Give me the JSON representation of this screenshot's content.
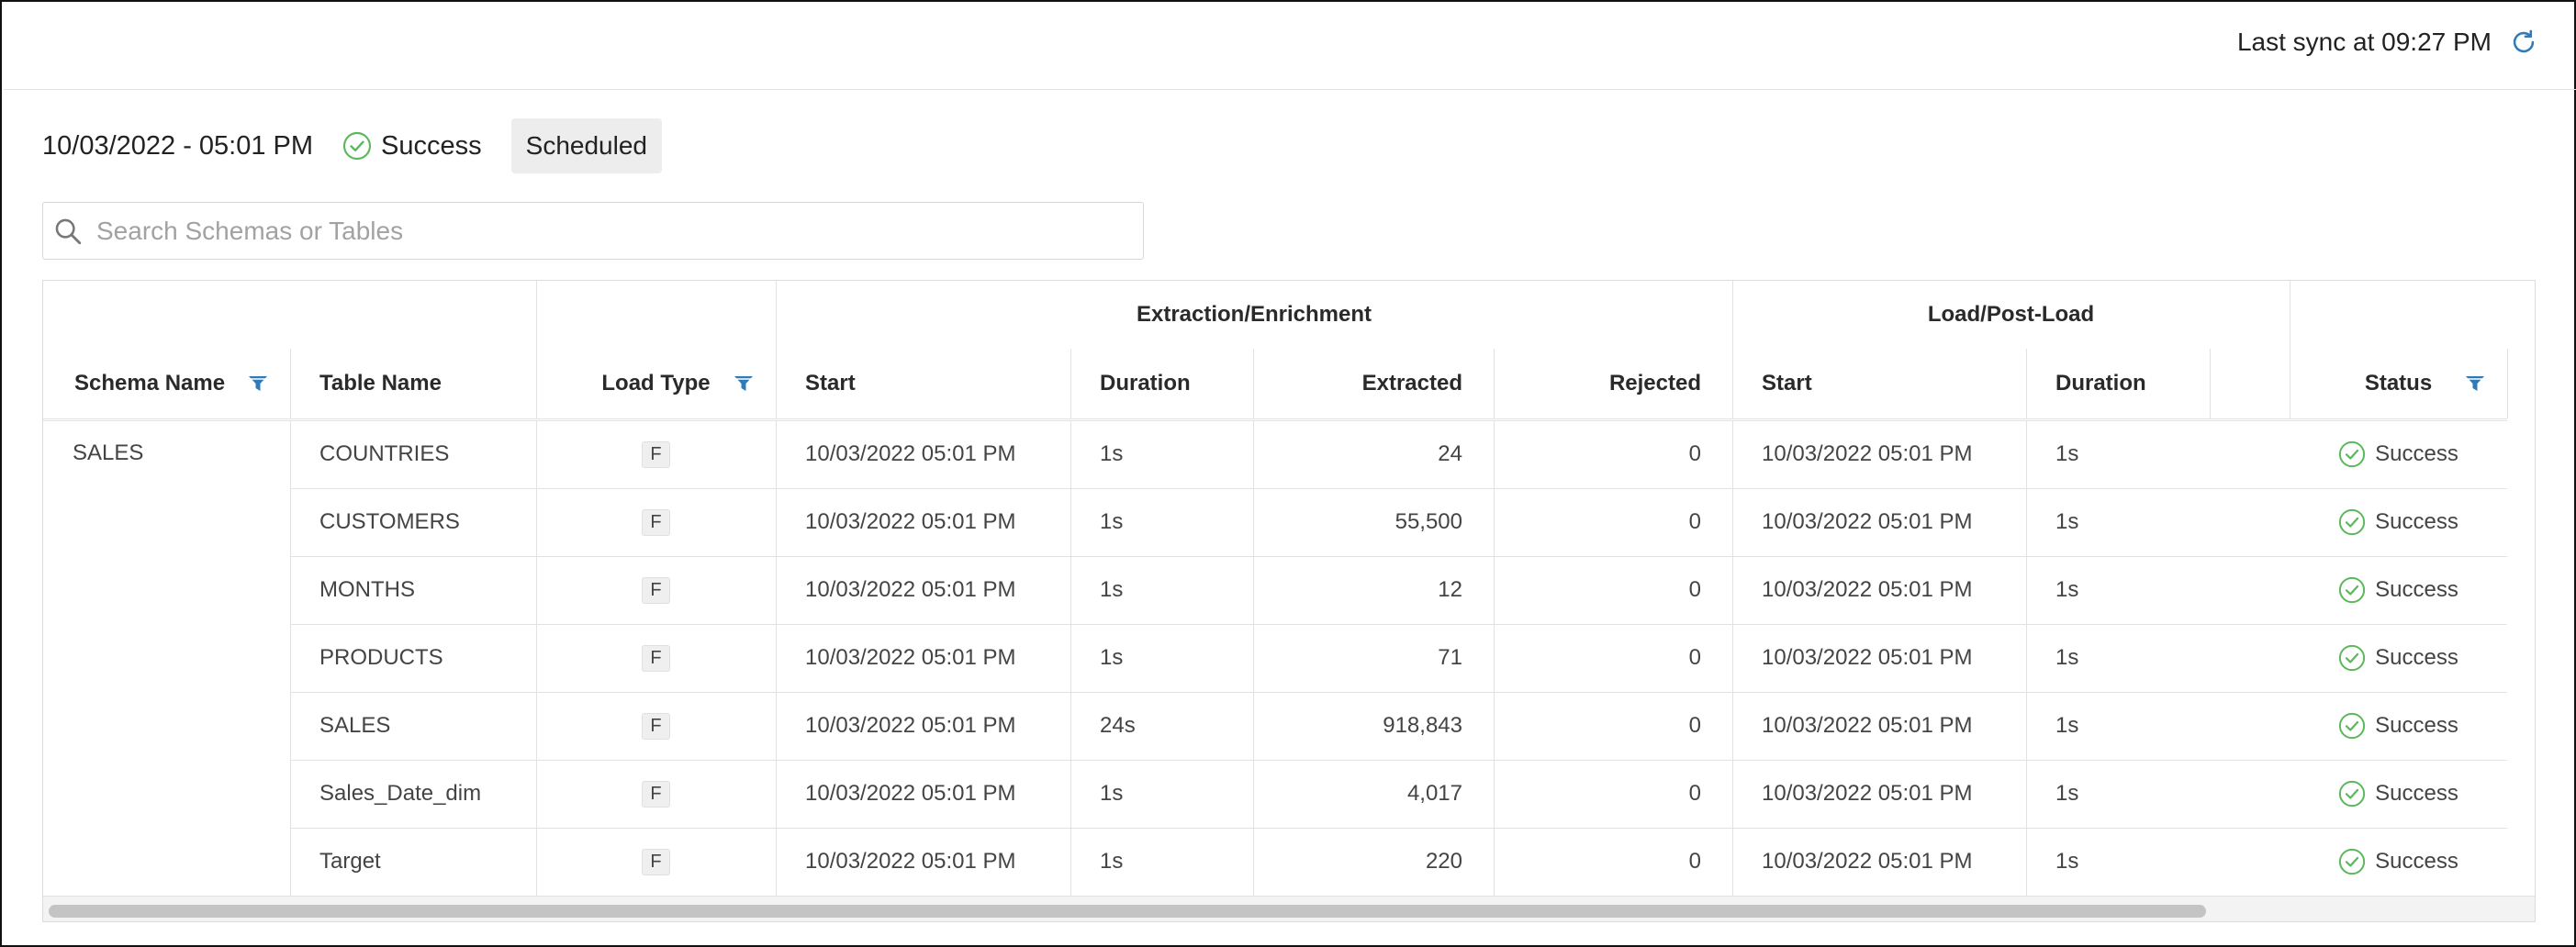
{
  "header": {
    "sync_text": "Last sync at 09:27 PM",
    "refresh_icon": "refresh-icon"
  },
  "run": {
    "date": "10/03/2022 - 05:01 PM",
    "status": "Success",
    "tag": "Scheduled"
  },
  "search": {
    "placeholder": "Search Schemas or Tables",
    "value": ""
  },
  "table": {
    "group_headers": {
      "extraction": "Extraction/Enrichment",
      "load": "Load/Post-Load"
    },
    "columns": {
      "schema": "Schema Name",
      "table": "Table Name",
      "load_type": "Load Type",
      "ext_start": "Start",
      "ext_duration": "Duration",
      "extracted": "Extracted",
      "rejected": "Rejected",
      "load_start": "Start",
      "load_duration": "Duration",
      "status": "Status"
    },
    "schema_value": "SALES",
    "rows": [
      {
        "table": "COUNTRIES",
        "load_type": "F",
        "ext_start": "10/03/2022 05:01 PM",
        "ext_duration": "1s",
        "extracted": "24",
        "rejected": "0",
        "load_start": "10/03/2022 05:01 PM",
        "load_duration": "1s",
        "status": "Success"
      },
      {
        "table": "CUSTOMERS",
        "load_type": "F",
        "ext_start": "10/03/2022 05:01 PM",
        "ext_duration": "1s",
        "extracted": "55,500",
        "rejected": "0",
        "load_start": "10/03/2022 05:01 PM",
        "load_duration": "1s",
        "status": "Success"
      },
      {
        "table": "MONTHS",
        "load_type": "F",
        "ext_start": "10/03/2022 05:01 PM",
        "ext_duration": "1s",
        "extracted": "12",
        "rejected": "0",
        "load_start": "10/03/2022 05:01 PM",
        "load_duration": "1s",
        "status": "Success"
      },
      {
        "table": "PRODUCTS",
        "load_type": "F",
        "ext_start": "10/03/2022 05:01 PM",
        "ext_duration": "1s",
        "extracted": "71",
        "rejected": "0",
        "load_start": "10/03/2022 05:01 PM",
        "load_duration": "1s",
        "status": "Success"
      },
      {
        "table": "SALES",
        "load_type": "F",
        "ext_start": "10/03/2022 05:01 PM",
        "ext_duration": "24s",
        "extracted": "918,843",
        "rejected": "0",
        "load_start": "10/03/2022 05:01 PM",
        "load_duration": "1s",
        "status": "Success"
      },
      {
        "table": "Sales_Date_dim",
        "load_type": "F",
        "ext_start": "10/03/2022 05:01 PM",
        "ext_duration": "1s",
        "extracted": "4,017",
        "rejected": "0",
        "load_start": "10/03/2022 05:01 PM",
        "load_duration": "1s",
        "status": "Success"
      },
      {
        "table": "Target",
        "load_type": "F",
        "ext_start": "10/03/2022 05:01 PM",
        "ext_duration": "1s",
        "extracted": "220",
        "rejected": "0",
        "load_start": "10/03/2022 05:01 PM",
        "load_duration": "1s",
        "status": "Success"
      }
    ]
  },
  "colors": {
    "success": "#5cb85c",
    "filter": "#2f7ab9",
    "refresh": "#2f7ab9"
  }
}
